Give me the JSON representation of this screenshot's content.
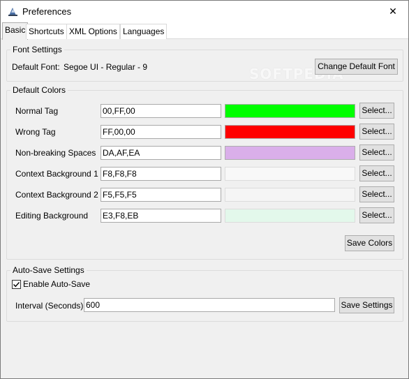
{
  "window": {
    "title": "Preferences",
    "close_glyph": "✕"
  },
  "tabs": [
    {
      "label": "Basic",
      "active": true
    },
    {
      "label": "Shortcuts",
      "active": false
    },
    {
      "label": "XML Options",
      "active": false
    },
    {
      "label": "Languages",
      "active": false
    }
  ],
  "font_settings": {
    "group_label": "Font Settings",
    "default_font_label": "Default Font:",
    "default_font_value": "Segoe UI - Regular - 9",
    "change_button": "Change Default Font"
  },
  "default_colors": {
    "group_label": "Default Colors",
    "select_label": "Select...",
    "save_button": "Save Colors",
    "rows": [
      {
        "label": "Normal Tag",
        "value": "00,FF,00",
        "swatch": "#00FF00"
      },
      {
        "label": "Wrong Tag",
        "value": "FF,00,00",
        "swatch": "#FF0000"
      },
      {
        "label": "Non-breaking Spaces",
        "value": "DA,AF,EA",
        "swatch": "#DAAFEA"
      },
      {
        "label": "Context Background 1",
        "value": "F8,F8,F8",
        "swatch": "#F8F8F8"
      },
      {
        "label": "Context Background 2",
        "value": "F5,F5,F5",
        "swatch": "#F5F5F5"
      },
      {
        "label": "Editing Background",
        "value": "E3,F8,EB",
        "swatch": "#E3F8EB"
      }
    ]
  },
  "auto_save": {
    "group_label": "Auto-Save Settings",
    "enable_label": "Enable Auto-Save",
    "enabled": true,
    "interval_label": "Interval (Seconds)",
    "interval_value": "600",
    "save_button": "Save Settings"
  },
  "watermark": "SOFTPEDIA"
}
